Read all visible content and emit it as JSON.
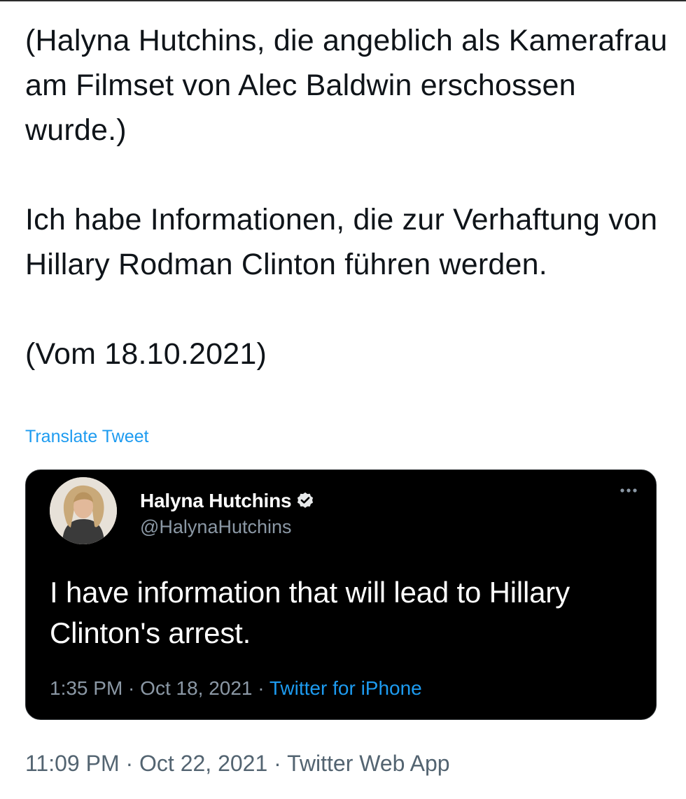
{
  "tweet": {
    "paragraphs": [
      "(Halyna Hutchins, die angeblich als Kamerafrau am Filmset von Alec Baldwin erschossen wurde.)",
      "Ich habe Informationen, die zur Verhaftung von Hillary Rodman Clinton führen werden.",
      "(Vom 18.10.2021)"
    ],
    "translate_label": "Translate Tweet",
    "timestamp": "11:09 PM · Oct 22, 2021 · ",
    "source_app": "Twitter Web App"
  },
  "quoted_tweet": {
    "display_name": "Halyna Hutchins",
    "handle": "@HalynaHutchins",
    "verified": true,
    "body": "I have information that will lead to Hillary Clinton's arrest.",
    "timestamp": "1:35 PM · Oct 18, 2021 · ",
    "source_app": "Twitter for iPhone",
    "icons": {
      "avatar": "avatar-photo",
      "verified": "verified-badge-icon",
      "more": "more-options-icon"
    }
  },
  "colors": {
    "link": "#1d9bf0",
    "text_dark": "#0f1419",
    "card_bg": "#000000",
    "muted": "#8b98a5",
    "footer_muted": "#536471"
  }
}
